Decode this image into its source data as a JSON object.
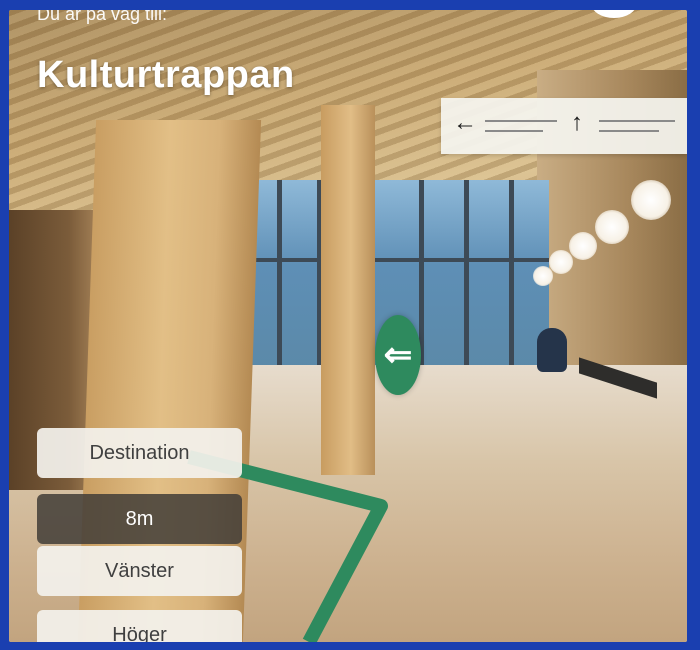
{
  "header": {
    "subtitle": "Du är på väg till:",
    "title": "Kulturtrappan"
  },
  "sign": {
    "left_arrow_icon": "arrow-left-icon",
    "up_arrow_icon": "arrow-up-icon"
  },
  "marker": {
    "icon": "arrow-left-icon",
    "glyph": "⇐",
    "color": "#2e8a5e"
  },
  "route": {
    "color": "#2e8a5e"
  },
  "buttons": {
    "destination": "Destination",
    "distance": "8m",
    "left": "Vänster",
    "right": "Höger"
  }
}
